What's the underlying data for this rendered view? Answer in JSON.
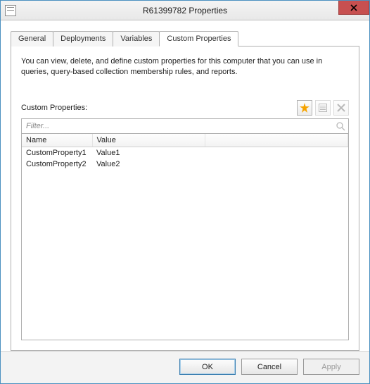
{
  "window": {
    "title": "R61399782 Properties"
  },
  "tabs": [
    {
      "label": "General"
    },
    {
      "label": "Deployments"
    },
    {
      "label": "Variables"
    },
    {
      "label": "Custom Properties",
      "active": true
    }
  ],
  "description": "You can view, delete, and define custom properties for this computer that you can use in queries, query-based collection membership rules, and reports.",
  "section_label": "Custom Properties:",
  "filter": {
    "placeholder": "Filter..."
  },
  "columns": {
    "name": "Name",
    "value": "Value"
  },
  "rows": [
    {
      "name": "CustomProperty1",
      "value": "Value1"
    },
    {
      "name": "CustomProperty2",
      "value": "Value2"
    }
  ],
  "buttons": {
    "ok": "OK",
    "cancel": "Cancel",
    "apply": "Apply"
  }
}
